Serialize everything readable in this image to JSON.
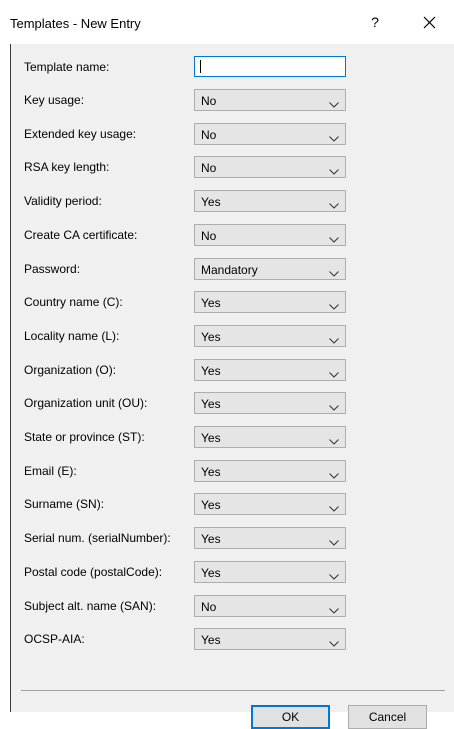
{
  "dialog": {
    "title": "Templates - New Entry",
    "help_glyph": "?",
    "ok_label": "OK",
    "cancel_label": "Cancel"
  },
  "template_name": {
    "label": "Template name:",
    "value": ""
  },
  "fields": [
    {
      "label": "Key usage:",
      "value": "No"
    },
    {
      "label": "Extended key usage:",
      "value": "No"
    },
    {
      "label": "RSA key length:",
      "value": "No"
    },
    {
      "label": "Validity period:",
      "value": "Yes"
    },
    {
      "label": "Create CA certificate:",
      "value": "No"
    },
    {
      "label": "Password:",
      "value": "Mandatory"
    },
    {
      "label": "Country name (C):",
      "value": "Yes"
    },
    {
      "label": "Locality name (L):",
      "value": "Yes"
    },
    {
      "label": "Organization (O):",
      "value": "Yes"
    },
    {
      "label": "Organization unit (OU):",
      "value": "Yes"
    },
    {
      "label": "State or province (ST):",
      "value": "Yes"
    },
    {
      "label": "Email (E):",
      "value": "Yes"
    },
    {
      "label": "Surname (SN):",
      "value": "Yes"
    },
    {
      "label": "Serial num. (serialNumber):",
      "value": "Yes"
    },
    {
      "label": "Postal code (postalCode):",
      "value": "Yes"
    },
    {
      "label": "Subject alt. name (SAN):",
      "value": "No"
    },
    {
      "label": "OCSP-AIA:",
      "value": "Yes"
    }
  ],
  "icons": {
    "help": "help-icon",
    "close": "close-icon",
    "dropdown": "chevron-down-icon"
  }
}
